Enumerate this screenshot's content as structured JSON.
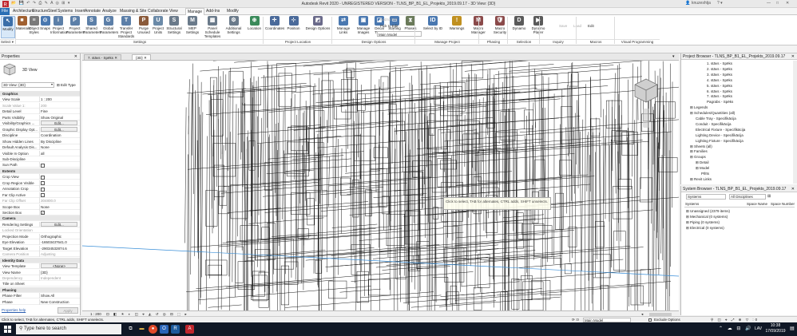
{
  "titlebar": {
    "title": "Autodesk Revit 2020 - UNREGISTERED VERSION - TLNS_BP_B1_EL_Projekts_2019.09.17 - 3D View: {3D}",
    "user": "knuzeshtja",
    "search_placeholder": ""
  },
  "tabs": [
    "File",
    "Architecture",
    "Structure",
    "Steel",
    "Systems",
    "Insert",
    "Annotate",
    "Analyze",
    "Massing & Site",
    "Collaborate",
    "View",
    "Manage",
    "Add-Ins",
    "Modify"
  ],
  "active_tab": "Manage",
  "ribbon": {
    "buttons": [
      {
        "label": "Modify",
        "color": "#3b6ea8",
        "icon": "↖"
      },
      {
        "label": "Materials",
        "color": "#a06030",
        "icon": "■"
      },
      {
        "label": "Object Styles",
        "color": "#7a7a7a",
        "icon": "≡"
      },
      {
        "label": "Snaps",
        "color": "#4a78b0",
        "icon": "⊙"
      },
      {
        "label": "Project Information",
        "color": "#5c7fa8",
        "icon": "i"
      },
      {
        "label": "Project Parameters",
        "color": "#5c7fa8",
        "icon": "P"
      },
      {
        "label": "Shared Parameters",
        "color": "#5c7fa8",
        "icon": "S"
      },
      {
        "label": "Global Parameters",
        "color": "#5c7fa8",
        "icon": "G"
      },
      {
        "label": "Transfer Project Standards",
        "color": "#5c7fa8",
        "icon": "T"
      },
      {
        "label": "Purge Unused",
        "color": "#8a5a3a",
        "icon": "P"
      },
      {
        "label": "Project Units",
        "color": "#6b8aa8",
        "icon": "U"
      },
      {
        "label": "Structural Settings",
        "color": "#6a7a8a",
        "icon": "S"
      },
      {
        "label": "MEP Settings",
        "color": "#6a7a8a",
        "icon": "M"
      },
      {
        "label": "Panel Schedule Templates",
        "color": "#6a7a8a",
        "icon": "▦"
      },
      {
        "label": "Additional Settings",
        "color": "#6a7a8a",
        "icon": "⚙"
      },
      {
        "label": "Location",
        "color": "#3a8a5a",
        "icon": "⊕"
      },
      {
        "label": "Coordinates",
        "color": "#4a6a9a",
        "icon": "✛"
      },
      {
        "label": "Position",
        "color": "#4a6a9a",
        "icon": "⊹"
      },
      {
        "label": "Design Options",
        "color": "#6a6a8a",
        "icon": "◩"
      },
      {
        "label": "Manage Links",
        "color": "#4a78b0",
        "icon": "⇄"
      },
      {
        "label": "Manage Images",
        "color": "#4a78b0",
        "icon": "▣"
      },
      {
        "label": "Decal Types",
        "color": "#4a78b0",
        "icon": "◪"
      },
      {
        "label": "Starting View",
        "color": "#4a78b0",
        "icon": "▭"
      },
      {
        "label": "Phases",
        "color": "#6a7a5a",
        "icon": "⧗"
      },
      {
        "label": "Select by ID",
        "color": "#4a78b0",
        "icon": "ID"
      },
      {
        "label": "Warnings",
        "color": "#c09020",
        "icon": "!"
      },
      {
        "label": "Macro Manager",
        "color": "#8a4a4a",
        "icon": "M"
      },
      {
        "label": "Macro Security",
        "color": "#8a4a4a",
        "icon": "🛡"
      },
      {
        "label": "Dynamo",
        "color": "#5a5a5a",
        "icon": "D"
      },
      {
        "label": "Dynamo Player",
        "color": "#5a5a5a",
        "icon": "▶"
      }
    ],
    "small_buttons": {
      "add_to_set": "Add to Set",
      "pick_to_edit": "Pick to Edit",
      "main_model": "Main Model",
      "save": "Save",
      "load": "Load",
      "edit": "Edit",
      "ids_of_selection": "IDs of Selection"
    },
    "groups": [
      "Select ▾",
      "Settings",
      "Project Location",
      "Design Options",
      "Manage Project",
      "Phasing",
      "Selection",
      "Inquiry",
      "Macros",
      "Visual Programming"
    ]
  },
  "properties": {
    "header": "Properties",
    "type_name": "3D View",
    "selector": "3D View: {3D}",
    "edit_type": "Edit Type",
    "rows": [
      {
        "k": "Graphics",
        "v": "",
        "t": "sec"
      },
      {
        "k": "View Scale",
        "v": "1 : 200"
      },
      {
        "k": "Scale Value  1:",
        "v": "200",
        "t": "gray"
      },
      {
        "k": "Detail Level",
        "v": "Fine"
      },
      {
        "k": "Parts Visibility",
        "v": "Show Original"
      },
      {
        "k": "Visibility/Graphics ...",
        "v": "Edit...",
        "t": "btn"
      },
      {
        "k": "Graphic Display Opt...",
        "v": "Edit...",
        "t": "btn"
      },
      {
        "k": "Discipline",
        "v": "Coordination"
      },
      {
        "k": "Show Hidden Lines",
        "v": "By Discipline"
      },
      {
        "k": "Default Analysis Dis...",
        "v": "None"
      },
      {
        "k": "Visible In Option",
        "v": "all"
      },
      {
        "k": "Sub-Discipline",
        "v": ""
      },
      {
        "k": "Sun Path",
        "v": "",
        "t": "chk"
      },
      {
        "k": "Extents",
        "v": "",
        "t": "sec"
      },
      {
        "k": "Crop View",
        "v": "",
        "t": "chk"
      },
      {
        "k": "Crop Region Visible",
        "v": "",
        "t": "chk"
      },
      {
        "k": "Annotation Crop",
        "v": "",
        "t": "chk"
      },
      {
        "k": "Far Clip Active",
        "v": "",
        "t": "chk"
      },
      {
        "k": "Far Clip Offset",
        "v": "304800.0",
        "t": "gray"
      },
      {
        "k": "Scope Box",
        "v": "None"
      },
      {
        "k": "Section Box",
        "v": "",
        "t": "chkon"
      },
      {
        "k": "Camera",
        "v": "",
        "t": "sec"
      },
      {
        "k": "Rendering Settings",
        "v": "Edit...",
        "t": "btn"
      },
      {
        "k": "Locked Orientation",
        "v": "",
        "t": "gray"
      },
      {
        "k": "Projection Mode",
        "v": "Orthographic"
      },
      {
        "k": "Eye Elevation",
        "v": "-16503437641.0"
      },
      {
        "k": "Target Elevation",
        "v": "-29034532874.6"
      },
      {
        "k": "Camera Position",
        "v": "Adjusting",
        "t": "gray"
      },
      {
        "k": "Identity Data",
        "v": "",
        "t": "sec"
      },
      {
        "k": "View Template",
        "v": "<None>",
        "t": "btn"
      },
      {
        "k": "View Name",
        "v": "{3D}"
      },
      {
        "k": "Dependency",
        "v": "Independent",
        "t": "gray"
      },
      {
        "k": "Title on Sheet",
        "v": ""
      },
      {
        "k": "Phasing",
        "v": "",
        "t": "sec"
      },
      {
        "k": "Phase Filter",
        "v": "Show All"
      },
      {
        "k": "Phase",
        "v": "New Construction"
      }
    ],
    "help": "Properties help",
    "apply": "Apply"
  },
  "view_tabs": [
    {
      "label": "7. stāvs - Spēks",
      "active": false
    },
    {
      "label": "{3D}",
      "active": true
    }
  ],
  "view_bar": {
    "scale": "1 : 200"
  },
  "tooltip": "Click to select, TAB for alternates, CTRL adds, SHIFT unselects.",
  "project_browser": {
    "header": "Project Browser - TLNS_BP_B1_EL_Projekts_2019.09.17",
    "items": [
      {
        "label": "1. stāvs - Spēks",
        "indent": 4
      },
      {
        "label": "2. stāvs - Spēks",
        "indent": 4
      },
      {
        "label": "3. stāvs - Spēks",
        "indent": 4
      },
      {
        "label": "4. stāvs - Spēks",
        "indent": 4
      },
      {
        "label": "5. stāvs - Spēks",
        "indent": 4
      },
      {
        "label": "6. stāvs - Spēks",
        "indent": 4
      },
      {
        "label": "7. stāvs - Spēks",
        "indent": 4
      },
      {
        "label": "Pagrabs - Spēks",
        "indent": 4
      },
      {
        "label": "Legends",
        "indent": 1
      },
      {
        "label": "Schedules/Quantities (all)",
        "indent": 1
      },
      {
        "label": "Cable Tray - Specifikācija",
        "indent": 2
      },
      {
        "label": "Conduit - Specifikācija",
        "indent": 2
      },
      {
        "label": "Electrical Fixture - Specifikācija",
        "indent": 2
      },
      {
        "label": "Lighting Device - Specifikācija",
        "indent": 2
      },
      {
        "label": "Lighting Fixture - Specifikācija",
        "indent": 2
      },
      {
        "label": "Sheets (all)",
        "indent": 1
      },
      {
        "label": "Families",
        "indent": 1
      },
      {
        "label": "Groups",
        "indent": 1
      },
      {
        "label": "Detail",
        "indent": 2
      },
      {
        "label": "Model",
        "indent": 2
      },
      {
        "label": "Pīlīts",
        "indent": 3
      },
      {
        "label": "Revit Links",
        "indent": 1
      }
    ]
  },
  "system_browser": {
    "header": "System Browser - TLNS_BP_B1_EL_Projekts_2019.09.17",
    "view_select": "Systems",
    "discipline_select": "All Disciplines",
    "columns": [
      "Systems",
      "Space Name",
      "Space Number"
    ],
    "rows": [
      {
        "label": "Unassigned (2379 items)"
      },
      {
        "label": "Mechanical (0 systems)"
      },
      {
        "label": "Piping (0 systems)"
      },
      {
        "label": "Electrical (0 systems)"
      }
    ]
  },
  "status": {
    "message": "Click to select, TAB for alternates, CTRL adds, SHIFT unselects.",
    "model": "Main Model",
    "exclude": "Exclude Options",
    "zero": ":0"
  },
  "taskbar": {
    "search_placeholder": "Type here to search",
    "lang": "LAV",
    "time": "10:38",
    "date": "17/09/2019"
  },
  "colors": {
    "file_tab": "#2a6fb5",
    "taskbar": "#101826",
    "wire": "#1a1a1a"
  }
}
